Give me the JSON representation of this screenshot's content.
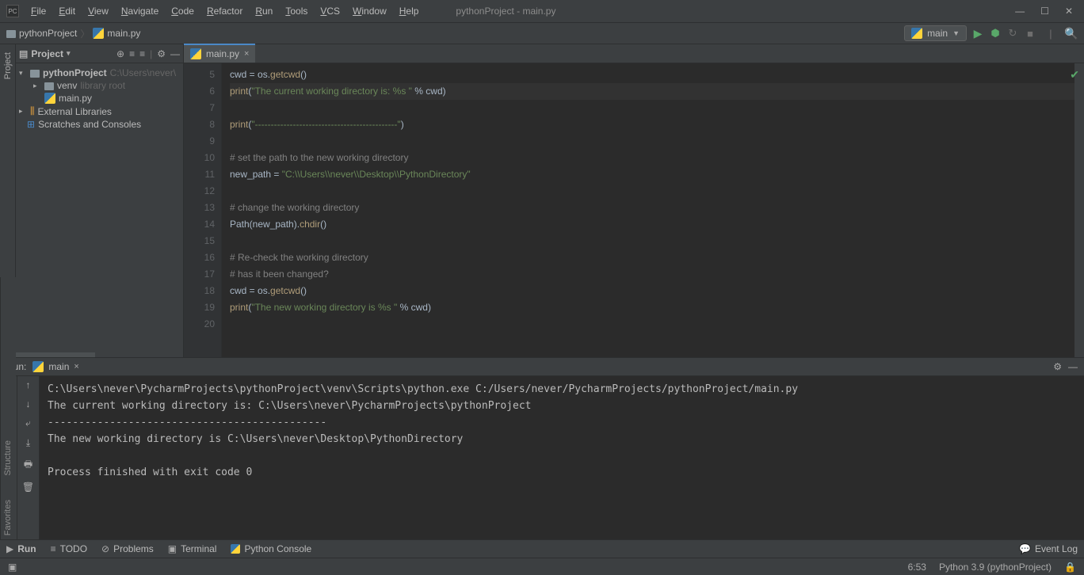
{
  "titlebar": {
    "title": "pythonProject - main.py"
  },
  "menus": [
    "File",
    "Edit",
    "View",
    "Navigate",
    "Code",
    "Refactor",
    "Run",
    "Tools",
    "VCS",
    "Window",
    "Help"
  ],
  "breadcrumb": {
    "project": "pythonProject",
    "file": "main.py"
  },
  "runconfig": {
    "name": "main"
  },
  "project_panel": {
    "title": "Project",
    "root": {
      "name": "pythonProject",
      "path": "C:\\Users\\never\\"
    },
    "venv": {
      "name": "venv",
      "note": "library root"
    },
    "file": "main.py",
    "ext_lib": "External Libraries",
    "scratches": "Scratches and Consoles"
  },
  "tab": {
    "name": "main.py"
  },
  "gutter_start": 5,
  "gutter_end": 20,
  "code_lines": [
    {
      "n": 5,
      "html": "cwd = os.<span class='fn'>getcwd</span>()"
    },
    {
      "n": 6,
      "html": "<span class='fn'>print</span>(<span class='str'>\"The current working directory is: %s \"</span> % cwd)",
      "hl": true
    },
    {
      "n": 7,
      "html": ""
    },
    {
      "n": 8,
      "html": "<span class='fn'>print</span>(<span class='str'>\"---------------------------------------------\"</span>)"
    },
    {
      "n": 9,
      "html": ""
    },
    {
      "n": 10,
      "html": "<span class='cmt'># set the path to the new working directory</span>"
    },
    {
      "n": 11,
      "html": "new_path = <span class='str'>\"C:\\\\Users\\\\never\\\\Desktop\\\\PythonDirectory\"</span>"
    },
    {
      "n": 12,
      "html": ""
    },
    {
      "n": 13,
      "html": "<span class='cmt'># change the working directory</span>"
    },
    {
      "n": 14,
      "html": "Path(new_path).<span class='fn'>chdir</span>()"
    },
    {
      "n": 15,
      "html": ""
    },
    {
      "n": 16,
      "html": "<span class='cmt'># Re-check the working directory</span>"
    },
    {
      "n": 17,
      "html": "<span class='cmt'># has it been changed?</span>"
    },
    {
      "n": 18,
      "html": "cwd = os.<span class='fn'>getcwd</span>()"
    },
    {
      "n": 19,
      "html": "<span class='fn'>print</span>(<span class='str'>\"The new working directory is %s \"</span> % cwd)"
    },
    {
      "n": 20,
      "html": ""
    }
  ],
  "run": {
    "label": "Run:",
    "config": "main",
    "output": [
      "C:\\Users\\never\\PycharmProjects\\pythonProject\\venv\\Scripts\\python.exe C:/Users/never/PycharmProjects/pythonProject/main.py",
      "The current working directory is: C:\\Users\\never\\PycharmProjects\\pythonProject ",
      "---------------------------------------------",
      "The new working directory is C:\\Users\\never\\Desktop\\PythonDirectory ",
      "",
      "Process finished with exit code 0"
    ]
  },
  "bottom_tabs": {
    "run": "Run",
    "todo": "TODO",
    "problems": "Problems",
    "terminal": "Terminal",
    "pyconsole": "Python Console",
    "eventlog": "Event Log"
  },
  "sidebar_labels": {
    "project": "Project",
    "structure": "Structure",
    "favorites": "Favorites"
  },
  "status": {
    "pos": "6:53",
    "interpreter": "Python 3.9 (pythonProject)"
  }
}
